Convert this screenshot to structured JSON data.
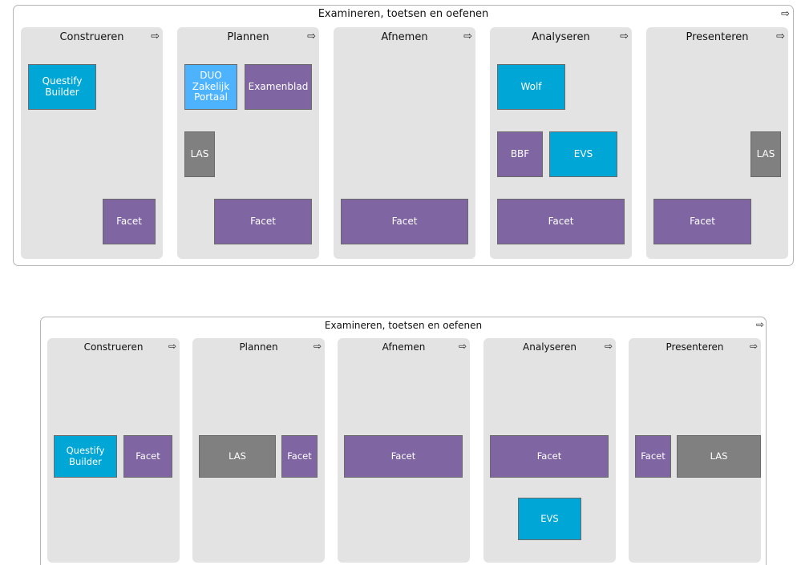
{
  "diagrams": [
    {
      "title": "Examineren, toetsen en oefenen",
      "arrow_icon": "right-arrow-icon",
      "columns": [
        {
          "title": "Construeren",
          "boxes": [
            {
              "label": "Questify\nBuilder",
              "color": "#00a6d6"
            },
            {
              "label": "Facet",
              "color": "#7f65a2"
            }
          ]
        },
        {
          "title": "Plannen",
          "boxes": [
            {
              "label": "DUO\nZakelijk\nPortaal",
              "color": "#4db3ff"
            },
            {
              "label": "Examenblad",
              "color": "#7f65a2"
            },
            {
              "label": "LAS",
              "color": "#808080"
            },
            {
              "label": "Facet",
              "color": "#7f65a2"
            }
          ]
        },
        {
          "title": "Afnemen",
          "boxes": [
            {
              "label": "Facet",
              "color": "#7f65a2"
            }
          ]
        },
        {
          "title": "Analyseren",
          "boxes": [
            {
              "label": "Wolf",
              "color": "#00a6d6"
            },
            {
              "label": "BBF",
              "color": "#7f65a2"
            },
            {
              "label": "EVS",
              "color": "#00a6d6"
            },
            {
              "label": "Facet",
              "color": "#7f65a2"
            }
          ]
        },
        {
          "title": "Presenteren",
          "boxes": [
            {
              "label": "LAS",
              "color": "#808080"
            },
            {
              "label": "Facet",
              "color": "#7f65a2"
            }
          ]
        }
      ]
    },
    {
      "title": "Examineren, toetsen en oefenen",
      "arrow_icon": "right-arrow-icon",
      "columns": [
        {
          "title": "Construeren",
          "boxes": [
            {
              "label": "Questify\nBuilder",
              "color": "#00a6d6"
            },
            {
              "label": "Facet",
              "color": "#7f65a2"
            }
          ]
        },
        {
          "title": "Plannen",
          "boxes": [
            {
              "label": "LAS",
              "color": "#808080"
            },
            {
              "label": "Facet",
              "color": "#7f65a2"
            }
          ]
        },
        {
          "title": "Afnemen",
          "boxes": [
            {
              "label": "Facet",
              "color": "#7f65a2"
            }
          ]
        },
        {
          "title": "Analyseren",
          "boxes": [
            {
              "label": "Facet",
              "color": "#7f65a2"
            },
            {
              "label": "EVS",
              "color": "#00a6d6"
            }
          ]
        },
        {
          "title": "Presenteren",
          "boxes": [
            {
              "label": "Facet",
              "color": "#7f65a2"
            },
            {
              "label": "LAS",
              "color": "#808080"
            }
          ]
        }
      ]
    }
  ]
}
